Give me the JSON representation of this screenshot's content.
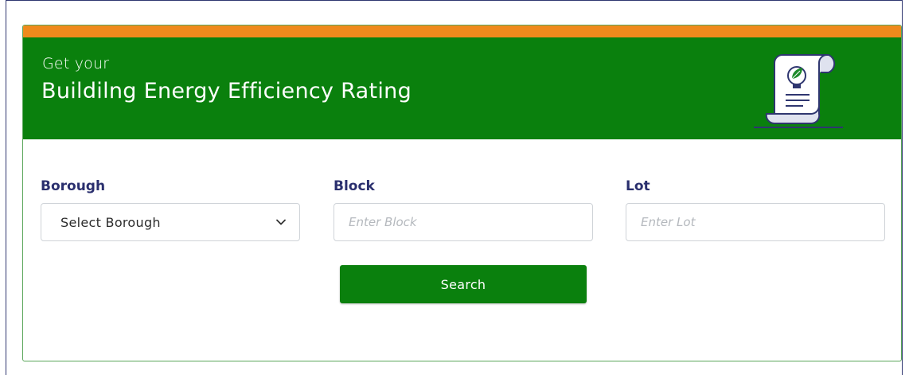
{
  "header": {
    "subtitle": "Get your",
    "title": "Buildilng Energy Efficiency Rating",
    "icon": "certificate-scroll-lightbulb-icon"
  },
  "form": {
    "borough": {
      "label": "Borough",
      "selected": "Select Borough"
    },
    "block": {
      "label": "Block",
      "placeholder": "Enter Block",
      "value": ""
    },
    "lot": {
      "label": "Lot",
      "placeholder": "Enter Lot",
      "value": ""
    },
    "search_label": "Search"
  },
  "colors": {
    "accent_orange": "#ef8a1c",
    "brand_green": "#0a800d",
    "label_navy": "#2a2f6e",
    "icon_navy": "#2f3670"
  }
}
